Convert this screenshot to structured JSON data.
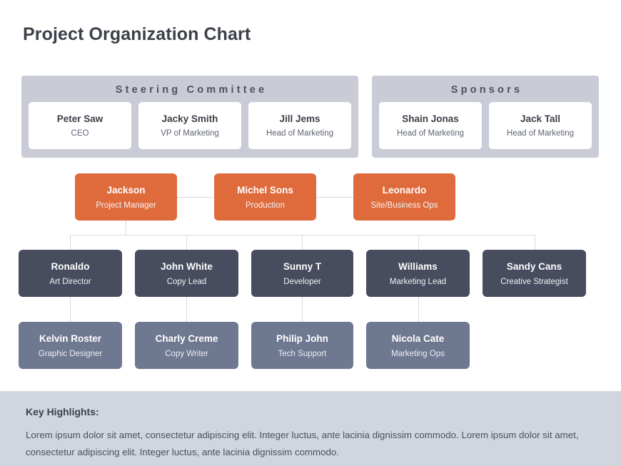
{
  "page": {
    "title": "Project Organization Chart"
  },
  "colors": {
    "manager": "#df6b3c",
    "lead": "#474c5e",
    "staff": "#6f7891",
    "panel": "#c9ccd6",
    "band": "#d1d5de",
    "connector": "#d8dade",
    "card": "#ffffff"
  },
  "groups": [
    {
      "id": "steering-committee",
      "title": "Steering Committee",
      "members": [
        {
          "name": "Peter Saw",
          "role": "CEO"
        },
        {
          "name": "Jacky Smith",
          "role": "VP of Marketing"
        },
        {
          "name": "Jill Jems",
          "role": "Head of Marketing"
        }
      ]
    },
    {
      "id": "sponsors",
      "title": "Sponsors",
      "members": [
        {
          "name": "Shain Jonas",
          "role": "Head of Marketing"
        },
        {
          "name": "Jack Tall",
          "role": "Head of Marketing"
        }
      ]
    }
  ],
  "managers": [
    {
      "name": "Jackson",
      "role": "Project Manager"
    },
    {
      "name": "Michel Sons",
      "role": "Production"
    },
    {
      "name": "Leonardo",
      "role": "Site/Business Ops"
    }
  ],
  "leads": [
    {
      "name": "Ronaldo",
      "role": "Art Director"
    },
    {
      "name": "John White",
      "role": "Copy Lead"
    },
    {
      "name": "Sunny T",
      "role": "Developer"
    },
    {
      "name": "Williams",
      "role": "Marketing Lead"
    },
    {
      "name": "Sandy Cans",
      "role": "Creative Strategist"
    }
  ],
  "staff": [
    {
      "name": "Kelvin Roster",
      "role": "Graphic Designer"
    },
    {
      "name": "Charly Creme",
      "role": "Copy Writer"
    },
    {
      "name": "Philip John",
      "role": "Tech Support"
    },
    {
      "name": "Nicola Cate",
      "role": "Marketing Ops"
    }
  ],
  "key_highlights": {
    "title": "Key Highlights:",
    "body": "Lorem ipsum dolor sit amet, consectetur adipiscing elit. Integer luctus, ante lacinia dignissim commodo. Lorem ipsum dolor sit amet, consectetur adipiscing elit. Integer luctus, ante lacinia dignissim commodo."
  }
}
